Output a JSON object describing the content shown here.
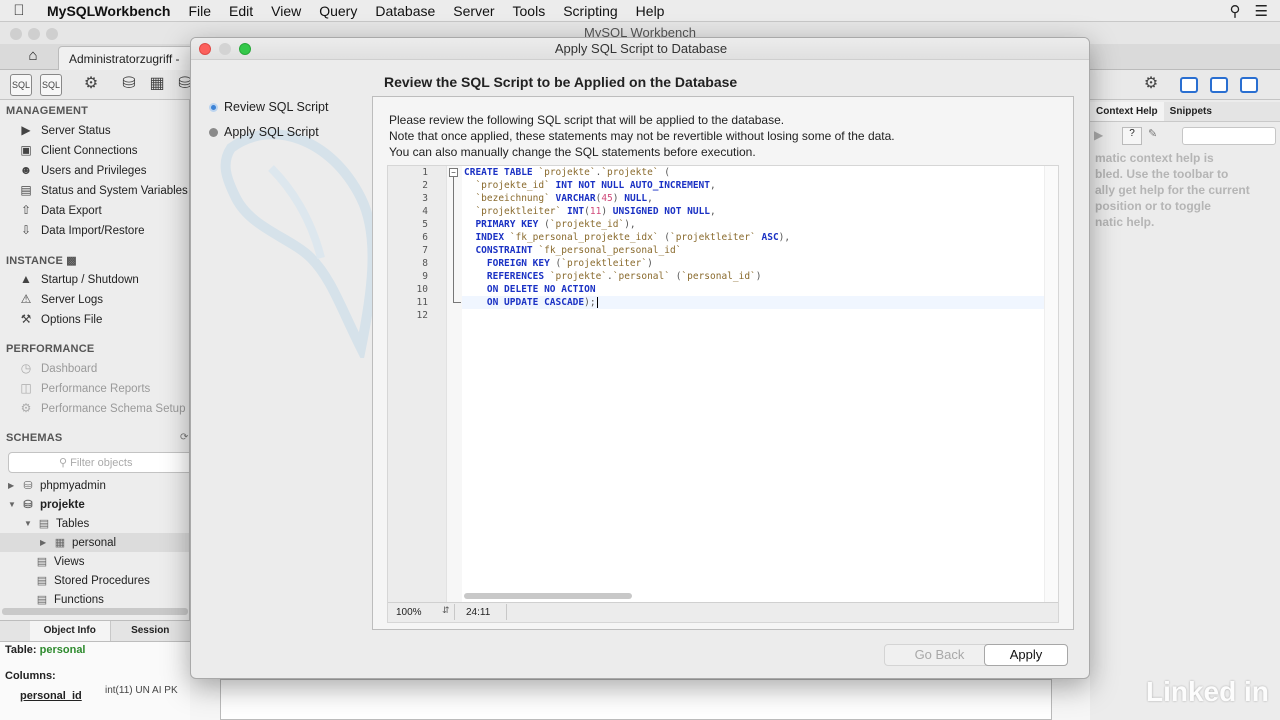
{
  "menubar": {
    "app_name": "MySQLWorkbench",
    "items": [
      "File",
      "Edit",
      "View",
      "Query",
      "Database",
      "Server",
      "Tools",
      "Scripting",
      "Help"
    ]
  },
  "window": {
    "title": "MySQL Workbench",
    "connection_tab": "Administratorzugriff -"
  },
  "sidebar": {
    "management": {
      "heading": "MANAGEMENT",
      "items": [
        "Server Status",
        "Client Connections",
        "Users and Privileges",
        "Status and System Variables",
        "Data Export",
        "Data Import/Restore"
      ]
    },
    "instance": {
      "heading": "INSTANCE",
      "items": [
        "Startup / Shutdown",
        "Server Logs",
        "Options File"
      ]
    },
    "performance": {
      "heading": "PERFORMANCE",
      "items": [
        "Dashboard",
        "Performance Reports",
        "Performance Schema Setup"
      ]
    },
    "schemas": {
      "heading": "SCHEMAS",
      "filter_placeholder": "Filter objects",
      "tree": [
        "phpmyadmin",
        "projekte",
        "Tables",
        "personal",
        "Views",
        "Stored Procedures",
        "Functions"
      ]
    }
  },
  "info_panel": {
    "tabs": [
      "Object Info",
      "Session"
    ],
    "table_label": "Table:",
    "table_name": "personal",
    "columns_label": "Columns:",
    "column_name": "personal_id",
    "column_type": "int(11) UN AI PK"
  },
  "right_panel": {
    "tabs": [
      "Context Help",
      "Snippets"
    ],
    "help_lines": [
      "matic context help is",
      "bled. Use the toolbar to",
      "ally get help for the current",
      "position or to toggle",
      "natic help."
    ]
  },
  "dialog": {
    "title": "Apply SQL Script to Database",
    "heading": "Review the SQL Script to be Applied on the Database",
    "steps": [
      "Review SQL Script",
      "Apply SQL Script"
    ],
    "notes": [
      "Please review the following SQL script that will be applied to the database.",
      "Note that once applied, these statements may not be revertible without losing some of the data.",
      "You can also manually change the SQL statements before execution."
    ],
    "line_numbers": [
      "1",
      "2",
      "3",
      "4",
      "5",
      "6",
      "7",
      "8",
      "9",
      "10",
      "11",
      "12"
    ],
    "status": {
      "zoom": "100%",
      "position": "24:11"
    },
    "buttons": {
      "go_back": "Go Back",
      "apply": "Apply"
    }
  },
  "watermark": "Linked in",
  "colors": {
    "accent": "#3b82d6",
    "keyword": "#1a31c4",
    "string": "#8a6b2e",
    "number": "#d04a7a"
  }
}
